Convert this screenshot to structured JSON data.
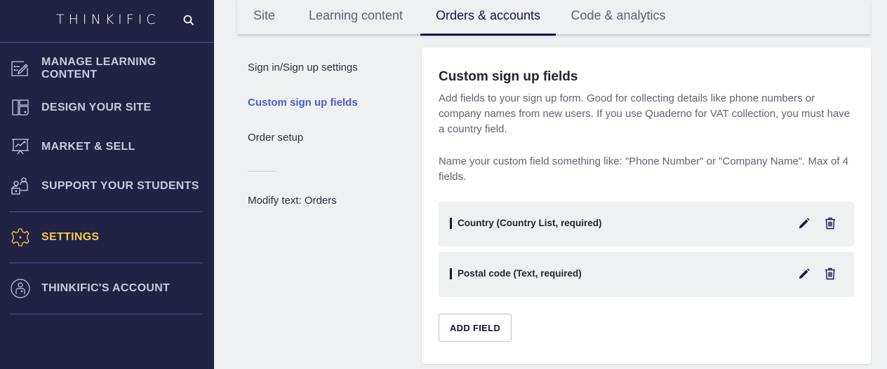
{
  "sidebar": {
    "brand": "THINKIFIC",
    "search_icon": "search-icon",
    "items": [
      {
        "label": "MANAGE LEARNING CONTENT",
        "icon": "edit-board-icon",
        "active": false
      },
      {
        "label": "DESIGN YOUR SITE",
        "icon": "layout-icon",
        "active": false
      },
      {
        "label": "MARKET & SELL",
        "icon": "presentation-chart-icon",
        "active": false
      },
      {
        "label": "SUPPORT YOUR STUDENTS",
        "icon": "users-icon",
        "active": false
      },
      {
        "label": "SETTINGS",
        "icon": "gear-icon",
        "active": true
      },
      {
        "label": "THINKIFIC'S ACCOUNT",
        "icon": "account-icon",
        "active": false
      }
    ],
    "active_color": "#f2c94c"
  },
  "tabs": [
    {
      "label": "Site",
      "active": false
    },
    {
      "label": "Learning content",
      "active": false
    },
    {
      "label": "Orders & accounts",
      "active": true
    },
    {
      "label": "Code & analytics",
      "active": false
    }
  ],
  "subnav": {
    "items": [
      {
        "label": "Sign in/Sign up settings",
        "active": false
      },
      {
        "label": "Custom sign up fields",
        "active": true
      },
      {
        "label": "Order setup",
        "active": false
      },
      {
        "label": "Modify text: Orders",
        "active": false
      }
    ],
    "active_color": "#4a5ccc"
  },
  "card": {
    "title": "Custom sign up fields",
    "description_1": "Add fields to your sign up form. Good for collecting details like phone numbers or company names from new users. If you use Quaderno for VAT collection, you must have a country field.",
    "description_2": "Name your custom field something like: \"Phone Number\" or \"Company Name\". Max of 4 fields.",
    "fields": [
      {
        "name": "Country (Country List, required)"
      },
      {
        "name": "Postal code (Text, required)"
      }
    ],
    "add_button": "ADD FIELD"
  }
}
